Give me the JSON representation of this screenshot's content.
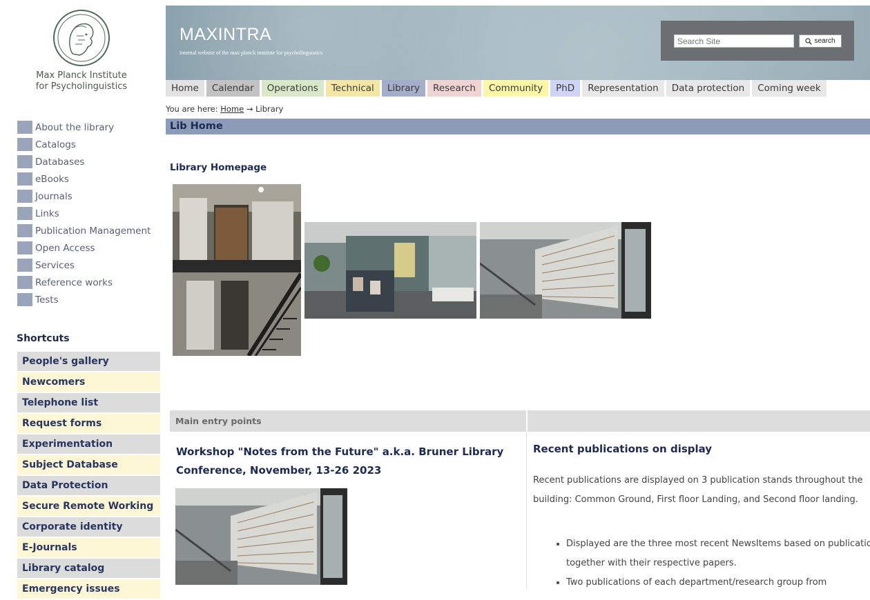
{
  "institute": {
    "line1": "Max Planck Institute",
    "line2": "for Psycholinguistics"
  },
  "site": {
    "title": "MAXINTRA",
    "subtitle": "internal website of the max planck institute for psycholinguistics"
  },
  "search": {
    "placeholder": "Search Site",
    "button_label": "search"
  },
  "nav": [
    {
      "label": "Home",
      "color": "#e2e2e2"
    },
    {
      "label": "Calendar",
      "color": "#c2c2c2"
    },
    {
      "label": "Operations",
      "color": "#d9e8c9"
    },
    {
      "label": "Technical",
      "color": "#f4e6a4"
    },
    {
      "label": "Library",
      "color": "#a4aec8"
    },
    {
      "label": "Research",
      "color": "#f0d3d3"
    },
    {
      "label": "Community",
      "color": "#fbf7a6"
    },
    {
      "label": "PhD",
      "color": "#d0d4f4"
    },
    {
      "label": "Representation",
      "color": "#e8e8e8"
    },
    {
      "label": "Data protection",
      "color": "#e8e8e8"
    },
    {
      "label": "Coming week",
      "color": "#e8e8e8"
    }
  ],
  "breadcrumb": {
    "prefix": "You are here:",
    "home": "Home",
    "separator": "→",
    "current": "Library"
  },
  "sidebar": {
    "items": [
      {
        "label": "About the library"
      },
      {
        "label": "Catalogs"
      },
      {
        "label": "Databases"
      },
      {
        "label": "eBooks"
      },
      {
        "label": "Journals"
      },
      {
        "label": "Links"
      },
      {
        "label": "Publication Management"
      },
      {
        "label": "Open Access"
      },
      {
        "label": "Services"
      },
      {
        "label": "Reference works"
      },
      {
        "label": "Tests"
      }
    ]
  },
  "shortcuts": {
    "title": "Shortcuts",
    "items": [
      {
        "label": "People's gallery",
        "style": "grey"
      },
      {
        "label": "Newcomers",
        "style": "yellow"
      },
      {
        "label": "Telephone list",
        "style": "grey"
      },
      {
        "label": "Request forms",
        "style": "yellow"
      },
      {
        "label": "Experimentation",
        "style": "grey"
      },
      {
        "label": "Subject Database",
        "style": "yellow"
      },
      {
        "label": "Data Protection",
        "style": "grey"
      },
      {
        "label": "Secure Remote Working",
        "style": "yellow"
      },
      {
        "label": "Corporate identity",
        "style": "grey"
      },
      {
        "label": "E-Journals",
        "style": "yellow"
      },
      {
        "label": "Library catalog",
        "style": "grey"
      },
      {
        "label": "Emergency issues",
        "style": "yellow"
      }
    ]
  },
  "main": {
    "bar_title": "Lib Home",
    "section_title": "Library Homepage",
    "entry_header": "Main entry points",
    "workshop_title": "Workshop \"Notes from the Future\" a.k.a. Bruner Library Conference,  November, 13-26 2023",
    "recent_title": "Recent publications on display",
    "recent_text": "Recent publications are displayed on 3 publication stands throughout the building: Common Ground, First floor Landing, and Second floor landing.",
    "recent_list": [
      "Displayed are the three most recent NewsItems based on publications together with their respective papers.",
      "Two publications of each department/research group from"
    ]
  },
  "colors": {
    "accent_dark": "#1d2a55",
    "lib_bar": "#8c9bb8",
    "side_square": "#9aa4ba"
  }
}
